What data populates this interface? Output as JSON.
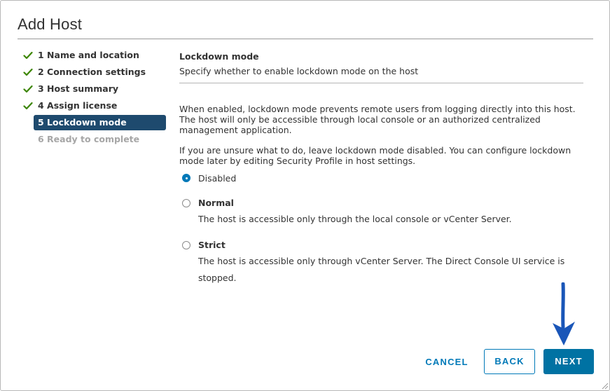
{
  "dialog": {
    "title": "Add Host"
  },
  "steps": [
    {
      "label": "1 Name and location",
      "state": "done"
    },
    {
      "label": "2 Connection settings",
      "state": "done"
    },
    {
      "label": "3 Host summary",
      "state": "done"
    },
    {
      "label": "4 Assign license",
      "state": "done"
    },
    {
      "label": "5 Lockdown mode",
      "state": "active"
    },
    {
      "label": "6 Ready to complete",
      "state": "future"
    }
  ],
  "content": {
    "heading": "Lockdown mode",
    "subheading": "Specify whether to enable lockdown mode on the host",
    "paragraph1": "When enabled, lockdown mode prevents remote users from logging directly into this host. The host will only be accessible through local console or an authorized centralized management application.",
    "paragraph2": "If you are unsure what to do, leave lockdown mode disabled. You can configure lockdown mode later by editing Security Profile in host settings."
  },
  "options": {
    "disabled": {
      "label": "Disabled",
      "selected": true
    },
    "normal": {
      "label": "Normal",
      "description": "The host is accessible only through the local console or vCenter Server.",
      "selected": false
    },
    "strict": {
      "label": "Strict",
      "description": "The host is accessible only through vCenter Server. The Direct Console UI service is stopped.",
      "selected": false
    }
  },
  "buttons": {
    "cancel": "CANCEL",
    "back": "BACK",
    "next": "NEXT"
  },
  "colors": {
    "accent": "#0079b8",
    "active_step_bg": "#1e4a6e",
    "check_green": "#3c8500",
    "arrow_blue": "#1a56b8"
  },
  "icons": {
    "step_done": "check-icon",
    "annotation": "arrow-down-icon",
    "resize": "resize-grip-icon"
  }
}
